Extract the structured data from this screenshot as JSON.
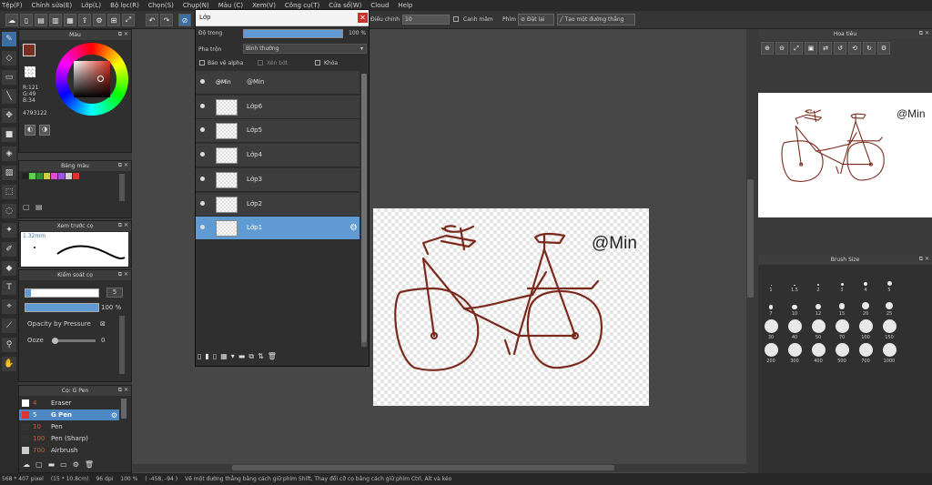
{
  "menu": [
    "Tệp(F)",
    "Chỉnh sửa(E)",
    "Lớp(L)",
    "Bộ lọc(R)",
    "Chọn(S)",
    "Chụp(N)",
    "Màu (C)",
    "Xem(V)",
    "Công cụ(T)",
    "Cửa sổ(W)",
    "Cloud",
    "Help"
  ],
  "toolbar": {
    "stabilizer_label": "Điều chỉnh",
    "stabilizer_value": "10",
    "snap_label": "Canh mâm",
    "brush_label": "Phím",
    "reset_label": "Đặt lại",
    "line_label": "Tạo một đường thẳng"
  },
  "color_panel": {
    "title": "Màu",
    "r": "R:121",
    "g": "G:49",
    "b": "B:34",
    "hex": "4793122",
    "primary_color": "#792e22"
  },
  "palette_panel": {
    "title": "Bảng màu",
    "swatches": [
      "#222222",
      "#5fcf4f",
      "#2e8f2e",
      "#cfcf3f",
      "#e04ad4",
      "#a050e0",
      "#d0d0d0",
      "#e03030"
    ]
  },
  "brush_preview": {
    "title": "Xem trước cọ",
    "size": "1.32mm"
  },
  "brush_control": {
    "title": "Kiểm soát cọ",
    "size_value": "5",
    "opacity_value": "100 %",
    "pressure_label": "Opacity by Pressure",
    "ooze_label": "Ooze",
    "ooze_value": "0"
  },
  "brush_list": {
    "title": "Cọ: G Pen",
    "items": [
      {
        "size": "4",
        "name": "Eraser",
        "color": "#ffffff"
      },
      {
        "size": "5",
        "name": "G Pen",
        "color": "#e03030"
      },
      {
        "size": "10",
        "name": "Pen",
        "color": "#333333"
      },
      {
        "size": "100",
        "name": "Pen (Sharp)",
        "color": "#333333"
      },
      {
        "size": "700",
        "name": "Airbrush",
        "color": "#cccccc"
      }
    ]
  },
  "layer_window": {
    "title": "Lớp",
    "opacity_label": "Độ trong",
    "opacity_value": "100 %",
    "blend_label": "Pha trộn",
    "blend_value": "Bình thường",
    "protect_alpha": "Bảo vệ alpha",
    "clipping": "Xén bớt",
    "lock": "Khóa",
    "layers": [
      "@Min",
      "Lớp6",
      "Lớp5",
      "Lớp4",
      "Lớp3",
      "Lớp2",
      "Lớp1"
    ],
    "layer_thumb_text": "@Min",
    "selected_index": 6
  },
  "canvas": {
    "watermark": "@Min",
    "stroke_color": "#7a2a1c"
  },
  "navigator": {
    "title": "Hoa tiêu",
    "watermark": "@Min"
  },
  "brush_size_panel": {
    "title": "Brush Size",
    "sizes": [
      "1",
      "1.5",
      "2",
      "3",
      "4",
      "5",
      "7",
      "10",
      "12",
      "15",
      "20",
      "25",
      "30",
      "40",
      "50",
      "70",
      "100",
      "150",
      "200",
      "300",
      "400",
      "500",
      "700",
      "1000"
    ]
  },
  "status": {
    "dims": "568 * 407 pixel",
    "cm": "(15 * 10.8cm)",
    "dpi": "96 dpi",
    "zoom": "100 %",
    "coords": "( -458, -94 )",
    "hint": "Vẽ một đường thẳng bằng cách giữ phím Shift, Thay đổi cỡ cọ bằng cách giữ phím Ctrl, Alt và kéo"
  }
}
